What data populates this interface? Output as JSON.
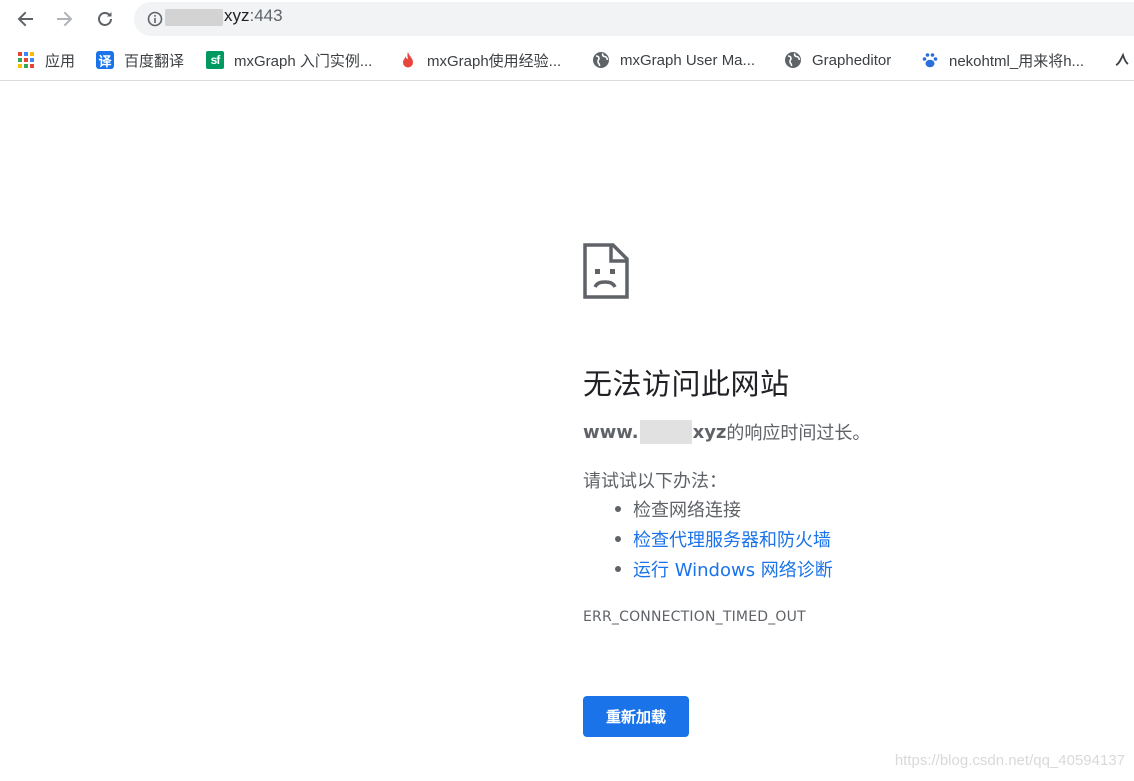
{
  "toolbar": {
    "back_icon": "arrow-left-icon",
    "forward_icon": "arrow-right-icon",
    "reload_icon": "reload-icon",
    "info_icon": "info-circle-icon",
    "url_host": "xyz",
    "url_port": ":443"
  },
  "bookmarks": [
    {
      "label": "应用",
      "icon": "apps-grid-icon"
    },
    {
      "label": "百度翻译",
      "icon": "translate-icon"
    },
    {
      "label": "mxGraph 入门实例...",
      "icon": "sf-icon"
    },
    {
      "label": "mxGraph使用经验...",
      "icon": "flame-icon"
    },
    {
      "label": "mxGraph User Ma...",
      "icon": "globe-icon"
    },
    {
      "label": "Grapheditor",
      "icon": "globe-icon"
    },
    {
      "label": "nekohtml_用来将h...",
      "icon": "paw-icon"
    }
  ],
  "error": {
    "icon": "sad-page-icon",
    "title": "无法访问此网站",
    "host_prefix": "www.",
    "host_suffix": "xyz",
    "message": " 的响应时间过长。",
    "try_label": "请试试以下办法：",
    "suggestions": [
      {
        "text": "检查网络连接",
        "link": false
      },
      {
        "text": "检查代理服务器和防火墙",
        "link": true
      },
      {
        "text": "运行 Windows 网络诊断",
        "link": true
      }
    ],
    "code": "ERR_CONNECTION_TIMED_OUT",
    "reload_label": "重新加载"
  },
  "watermark": "https://blog.csdn.net/qq_40594137",
  "colors": {
    "accent": "#1a73e8",
    "text_secondary": "#5f6368",
    "omnibox_bg": "#f1f3f4"
  }
}
